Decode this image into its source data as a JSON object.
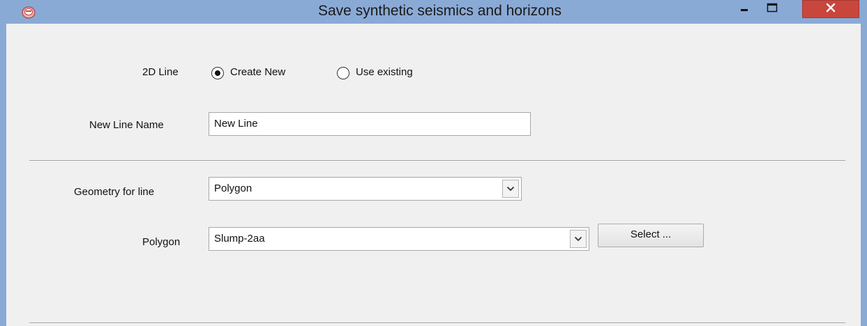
{
  "window": {
    "title": "Save synthetic seismics and horizons",
    "icons": {
      "app": "app-logo-icon",
      "minimize": "minimize-icon",
      "maximize": "maximize-icon",
      "close": "close-icon"
    },
    "colors": {
      "frame": "#8aaad6",
      "close_button": "#c9463d",
      "content_bg": "#f0f0f0"
    }
  },
  "form": {
    "line_2d": {
      "label": "2D Line",
      "options": [
        {
          "label": "Create New",
          "selected": true
        },
        {
          "label": "Use existing",
          "selected": false
        }
      ]
    },
    "new_line_name": {
      "label": "New Line Name",
      "value": "New Line"
    },
    "geometry": {
      "label": "Geometry for line",
      "value": "Polygon"
    },
    "polygon": {
      "label": "Polygon",
      "value": "Slump-2aa",
      "select_button": "Select ..."
    }
  }
}
